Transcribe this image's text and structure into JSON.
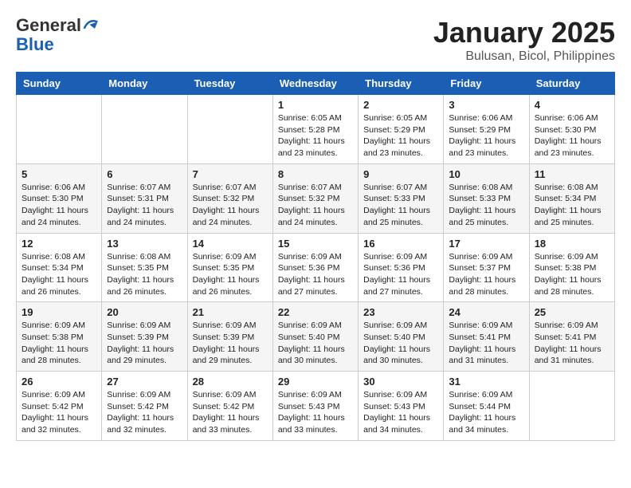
{
  "header": {
    "logo_general": "General",
    "logo_blue": "Blue",
    "month_title": "January 2025",
    "location": "Bulusan, Bicol, Philippines"
  },
  "weekdays": [
    "Sunday",
    "Monday",
    "Tuesday",
    "Wednesday",
    "Thursday",
    "Friday",
    "Saturday"
  ],
  "weeks": [
    [
      {
        "day": "",
        "info": ""
      },
      {
        "day": "",
        "info": ""
      },
      {
        "day": "",
        "info": ""
      },
      {
        "day": "1",
        "info": "Sunrise: 6:05 AM\nSunset: 5:28 PM\nDaylight: 11 hours\nand 23 minutes."
      },
      {
        "day": "2",
        "info": "Sunrise: 6:05 AM\nSunset: 5:29 PM\nDaylight: 11 hours\nand 23 minutes."
      },
      {
        "day": "3",
        "info": "Sunrise: 6:06 AM\nSunset: 5:29 PM\nDaylight: 11 hours\nand 23 minutes."
      },
      {
        "day": "4",
        "info": "Sunrise: 6:06 AM\nSunset: 5:30 PM\nDaylight: 11 hours\nand 23 minutes."
      }
    ],
    [
      {
        "day": "5",
        "info": "Sunrise: 6:06 AM\nSunset: 5:30 PM\nDaylight: 11 hours\nand 24 minutes."
      },
      {
        "day": "6",
        "info": "Sunrise: 6:07 AM\nSunset: 5:31 PM\nDaylight: 11 hours\nand 24 minutes."
      },
      {
        "day": "7",
        "info": "Sunrise: 6:07 AM\nSunset: 5:32 PM\nDaylight: 11 hours\nand 24 minutes."
      },
      {
        "day": "8",
        "info": "Sunrise: 6:07 AM\nSunset: 5:32 PM\nDaylight: 11 hours\nand 24 minutes."
      },
      {
        "day": "9",
        "info": "Sunrise: 6:07 AM\nSunset: 5:33 PM\nDaylight: 11 hours\nand 25 minutes."
      },
      {
        "day": "10",
        "info": "Sunrise: 6:08 AM\nSunset: 5:33 PM\nDaylight: 11 hours\nand 25 minutes."
      },
      {
        "day": "11",
        "info": "Sunrise: 6:08 AM\nSunset: 5:34 PM\nDaylight: 11 hours\nand 25 minutes."
      }
    ],
    [
      {
        "day": "12",
        "info": "Sunrise: 6:08 AM\nSunset: 5:34 PM\nDaylight: 11 hours\nand 26 minutes."
      },
      {
        "day": "13",
        "info": "Sunrise: 6:08 AM\nSunset: 5:35 PM\nDaylight: 11 hours\nand 26 minutes."
      },
      {
        "day": "14",
        "info": "Sunrise: 6:09 AM\nSunset: 5:35 PM\nDaylight: 11 hours\nand 26 minutes."
      },
      {
        "day": "15",
        "info": "Sunrise: 6:09 AM\nSunset: 5:36 PM\nDaylight: 11 hours\nand 27 minutes."
      },
      {
        "day": "16",
        "info": "Sunrise: 6:09 AM\nSunset: 5:36 PM\nDaylight: 11 hours\nand 27 minutes."
      },
      {
        "day": "17",
        "info": "Sunrise: 6:09 AM\nSunset: 5:37 PM\nDaylight: 11 hours\nand 28 minutes."
      },
      {
        "day": "18",
        "info": "Sunrise: 6:09 AM\nSunset: 5:38 PM\nDaylight: 11 hours\nand 28 minutes."
      }
    ],
    [
      {
        "day": "19",
        "info": "Sunrise: 6:09 AM\nSunset: 5:38 PM\nDaylight: 11 hours\nand 28 minutes."
      },
      {
        "day": "20",
        "info": "Sunrise: 6:09 AM\nSunset: 5:39 PM\nDaylight: 11 hours\nand 29 minutes."
      },
      {
        "day": "21",
        "info": "Sunrise: 6:09 AM\nSunset: 5:39 PM\nDaylight: 11 hours\nand 29 minutes."
      },
      {
        "day": "22",
        "info": "Sunrise: 6:09 AM\nSunset: 5:40 PM\nDaylight: 11 hours\nand 30 minutes."
      },
      {
        "day": "23",
        "info": "Sunrise: 6:09 AM\nSunset: 5:40 PM\nDaylight: 11 hours\nand 30 minutes."
      },
      {
        "day": "24",
        "info": "Sunrise: 6:09 AM\nSunset: 5:41 PM\nDaylight: 11 hours\nand 31 minutes."
      },
      {
        "day": "25",
        "info": "Sunrise: 6:09 AM\nSunset: 5:41 PM\nDaylight: 11 hours\nand 31 minutes."
      }
    ],
    [
      {
        "day": "26",
        "info": "Sunrise: 6:09 AM\nSunset: 5:42 PM\nDaylight: 11 hours\nand 32 minutes."
      },
      {
        "day": "27",
        "info": "Sunrise: 6:09 AM\nSunset: 5:42 PM\nDaylight: 11 hours\nand 32 minutes."
      },
      {
        "day": "28",
        "info": "Sunrise: 6:09 AM\nSunset: 5:42 PM\nDaylight: 11 hours\nand 33 minutes."
      },
      {
        "day": "29",
        "info": "Sunrise: 6:09 AM\nSunset: 5:43 PM\nDaylight: 11 hours\nand 33 minutes."
      },
      {
        "day": "30",
        "info": "Sunrise: 6:09 AM\nSunset: 5:43 PM\nDaylight: 11 hours\nand 34 minutes."
      },
      {
        "day": "31",
        "info": "Sunrise: 6:09 AM\nSunset: 5:44 PM\nDaylight: 11 hours\nand 34 minutes."
      },
      {
        "day": "",
        "info": ""
      }
    ]
  ]
}
